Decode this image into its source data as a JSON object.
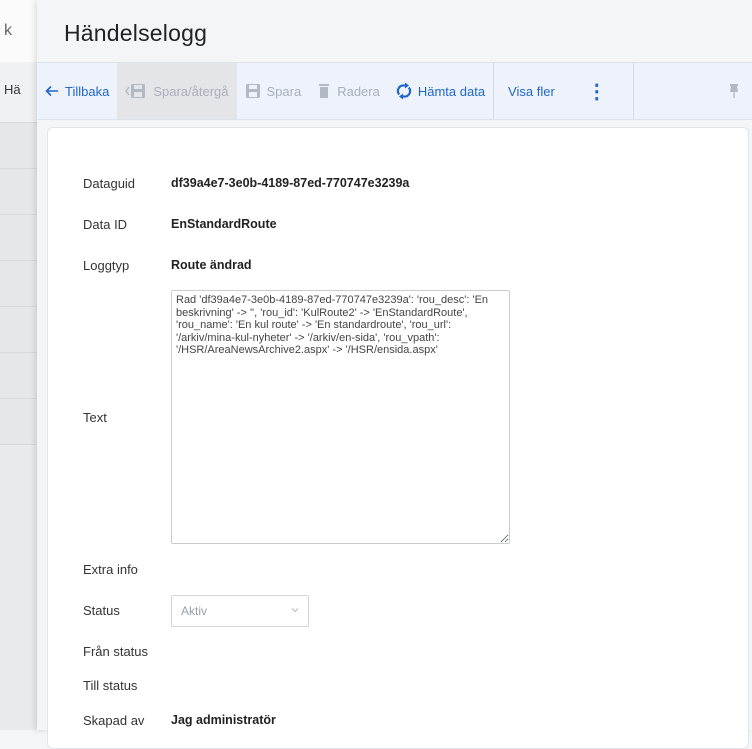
{
  "background": {
    "top_text": "k",
    "tool_text": "Hä"
  },
  "dialog": {
    "title": "Händelselogg"
  },
  "toolbar": {
    "back": "Tillbaka",
    "save_revert": "Spara/återgå",
    "save": "Spara",
    "delete": "Radera",
    "fetch": "Hämta data",
    "show_more": "Visa fler",
    "more_menu": "⋮"
  },
  "fields": {
    "dataguid": {
      "label": "Dataguid",
      "value": "df39a4e7-3e0b-4189-87ed-770747e3239a"
    },
    "data_id": {
      "label": "Data ID",
      "value": "EnStandardRoute"
    },
    "log_type": {
      "label": "Loggtyp",
      "value": "Route ändrad"
    },
    "text": {
      "label": "Text",
      "value": "Rad 'df39a4e7-3e0b-4189-87ed-770747e3239a': 'rou_desc': 'En beskrivning' -> '', 'rou_id': 'KulRoute2' -> 'EnStandardRoute', 'rou_name': 'En kul route' -> 'En standardroute', 'rou_url': '/arkiv/mina-kul-nyheter' -> '/arkiv/en-sida', 'rou_vpath': '/HSR/AreaNewsArchive2.aspx' -> '/HSR/ensida.aspx'"
    },
    "extra_info": {
      "label": "Extra info",
      "value": ""
    },
    "status": {
      "label": "Status",
      "value": "Aktiv"
    },
    "from_status": {
      "label": "Från status",
      "value": ""
    },
    "to_status": {
      "label": "Till status",
      "value": ""
    },
    "created_by": {
      "label": "Skapad av",
      "value": "Jag administratör"
    }
  },
  "colors": {
    "accent": "#1f66c9",
    "disabled": "#a8afba",
    "toolbar_bg": "#eef3fb"
  }
}
